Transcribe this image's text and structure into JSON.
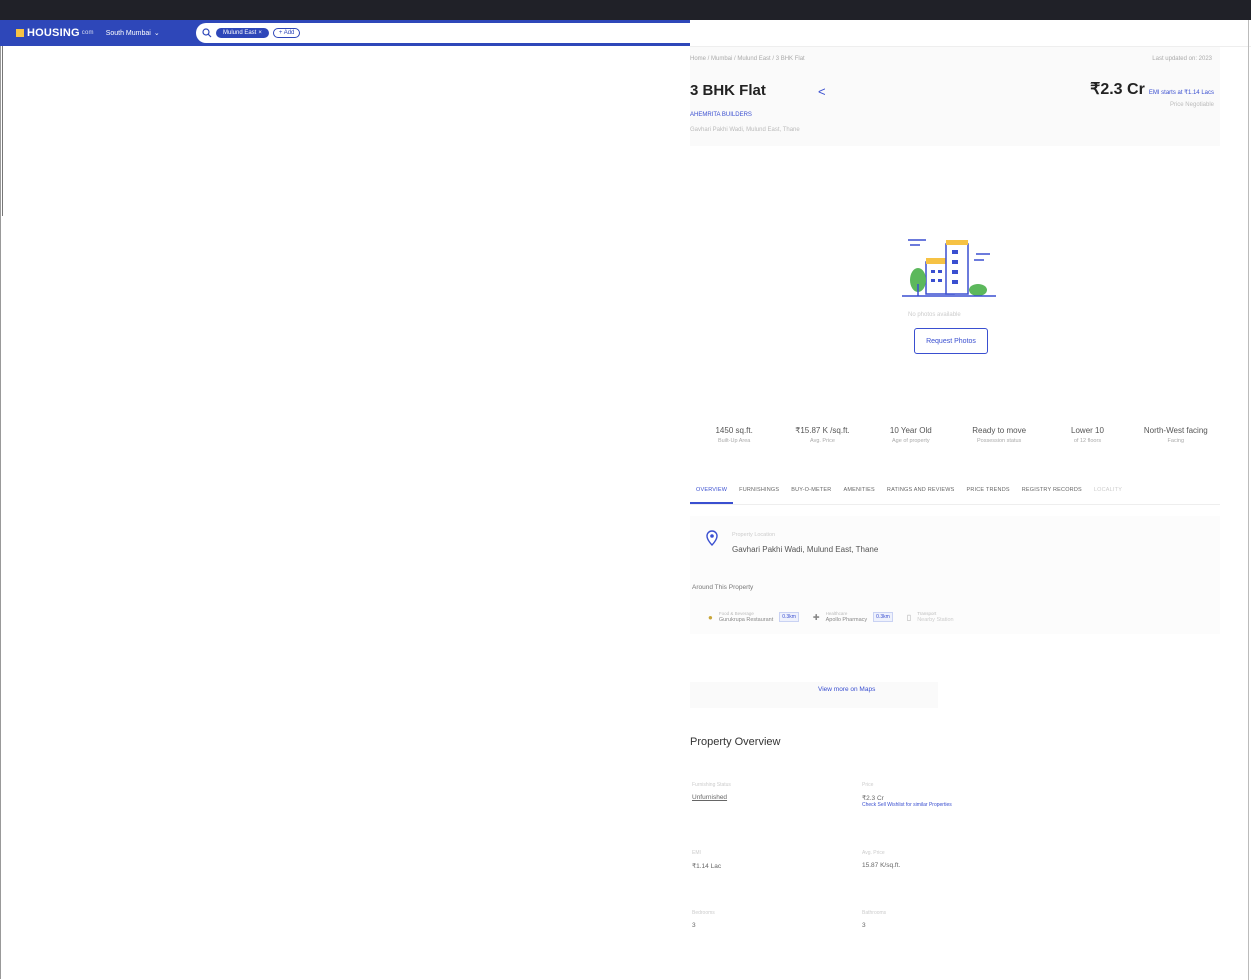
{
  "header": {
    "logo_text": "HOUSING",
    "logo_suffix": "com",
    "city": "South Mumbai",
    "search_chip": "Mulund East",
    "more_chip": "+ Add"
  },
  "property": {
    "breadcrumb": "Home / Mumbai / Mulund East / 3 BHK Flat",
    "updated": "Last updated on: 2023",
    "title": "3 BHK Flat",
    "price": "₹2.3 Cr",
    "emi": "EMI starts at ₹1.14 Lacs",
    "negotiable": "Price Negotiable",
    "builder": "AHEMRITA BUILDERS",
    "locality": "Gavhari Pakhi Wadi, Mulund East, Thane",
    "no_photo": "No photos available",
    "request_photos": "Request Photos"
  },
  "stats": [
    {
      "value": "1450 sq.ft.",
      "label": "Built-Up Area"
    },
    {
      "value": "₹15.87 K /sq.ft.",
      "label": "Avg. Price"
    },
    {
      "value": "10 Year Old",
      "label": "Age of property"
    },
    {
      "value": "Ready to move",
      "label": "Possession status"
    },
    {
      "value": "Lower 10",
      "label": "of 12 floors"
    },
    {
      "value": "North-West facing",
      "label": "Facing"
    }
  ],
  "tabs": [
    "OVERVIEW",
    "FURNISHINGS",
    "BUY-O-METER",
    "AMENITIES",
    "RATINGS AND REVIEWS",
    "PRICE TRENDS",
    "REGISTRY RECORDS",
    "LOCALITY"
  ],
  "location": {
    "small_label": "Property Location",
    "address": "Gavhari Pakhi Wadi, Mulund East, Thane",
    "around": "Around This Property",
    "places": [
      {
        "category": "Food & Beverage",
        "name": "Gurukrupa Restaurant",
        "distance": "0.3km"
      },
      {
        "category": "Healthcare",
        "name": "Apollo Pharmacy",
        "distance": "0.3km"
      },
      {
        "category": "Transport",
        "name": "Nearby Station",
        "distance": ""
      }
    ],
    "map_link": "View more on Maps"
  },
  "overview": {
    "title": "Property Overview",
    "items": [
      {
        "label": "Furnishing Status",
        "value": "Unfurnished",
        "link": ""
      },
      {
        "label": "Price",
        "value": "₹2.3 Cr",
        "link": "Check Sell Wishlist for similar Properties"
      },
      {
        "label": "EMI",
        "value": "₹1.14 Lac",
        "link": ""
      },
      {
        "label": "Avg. Price",
        "value": "15.87 K/sq.ft.",
        "link": ""
      },
      {
        "label": "Bedrooms",
        "value": "3",
        "link": ""
      },
      {
        "label": "Bathrooms",
        "value": "3",
        "link": ""
      }
    ]
  }
}
